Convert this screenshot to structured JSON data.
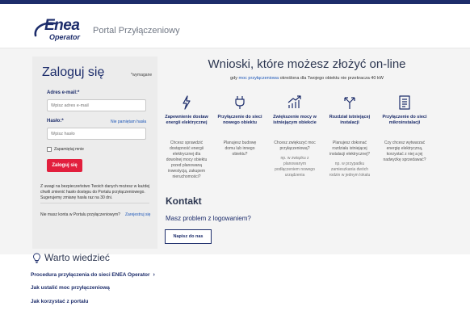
{
  "header": {
    "logo_main": "Enea",
    "logo_sub": "Operator",
    "portal_title": "Portal Przyłączeniowy"
  },
  "login": {
    "title": "Zaloguj się",
    "required_note": "*wymagane",
    "email_label": "Adres e-mail:*",
    "email_placeholder": "Wpisz adres e-mail",
    "password_label": "Hasło:*",
    "forgot_link": "Nie pamiętam hasła",
    "password_placeholder": "Wpisz hasło",
    "remember_label": "Zapamiętaj mnie",
    "submit_label": "Zaloguj się",
    "notice": "Z uwagi na bezpieczeństwo Twoich danych możesz w każdej chwili zmienić hasło dostępu do Portalu przyłączeniowego. Sugerujemy zmianę hasła raz na 30 dni.",
    "no_account_text": "Nie masz konta w Portalu przyłączeniowym?",
    "register_link": "Zarejestruj się"
  },
  "main": {
    "title": "Wnioski, które możesz złożyć on-line",
    "subtitle_pre": "gdy",
    "subtitle_link": "moc przyłączeniowa",
    "subtitle_post": "określona dla Twojego obiektu nie przekracza 40 kW",
    "columns": [
      {
        "icon": "lightning-icon",
        "title": "Zapewnienie dostaw energii elektrycznej",
        "desc": "Chcesz sprawdzić dostępność energii elektrycznej dla dowolnej mocy obiektu przed planowaną inwestycją, zakupem nieruchomości?"
      },
      {
        "icon": "plug-icon",
        "title": "Przyłączenie do sieci nowego obiektu",
        "desc": "Planujesz budowę domu lub innego obiektu?"
      },
      {
        "icon": "chart-up-icon",
        "title": "Zwiększenie mocy w istniejącym obiekcie",
        "desc": "Chcesz zwiększyć moc przyłączeniową?",
        "desc2": "np. w związku z planowanym podłączeniem nowego urządzenia"
      },
      {
        "icon": "split-arrows-icon",
        "title": "Rozdział istniejącej instalacji",
        "desc": "Planujesz dokonać rozdziału istniejącej instalacji elektrycznej?",
        "desc2": "np. w przypadku zamieszkania dwóch rodzin w jednym lokalu"
      },
      {
        "icon": "document-icon",
        "title": "Przyłączenie do sieci mikroinstalacji",
        "desc": "Czy chcesz wytwarzać energię elektryczną, korzystać z niej a jej nadwyżkę sprzedawać?"
      }
    ],
    "contact_title": "Kontakt",
    "contact_question": "Masz problem z logowaniem?",
    "contact_button": "Napisz do nas"
  },
  "info": {
    "title": "Warto wiedzieć",
    "links": [
      "Procedura przyłączenia do sieci ENEA Operator",
      "Jak ustalić moc przyłączeniową",
      "Jak korzystać z portalu"
    ],
    "chevron": "›"
  },
  "colors": {
    "brand_navy": "#1d2d6b",
    "accent_red": "#e21f3d",
    "link_blue": "#1d57b8"
  }
}
